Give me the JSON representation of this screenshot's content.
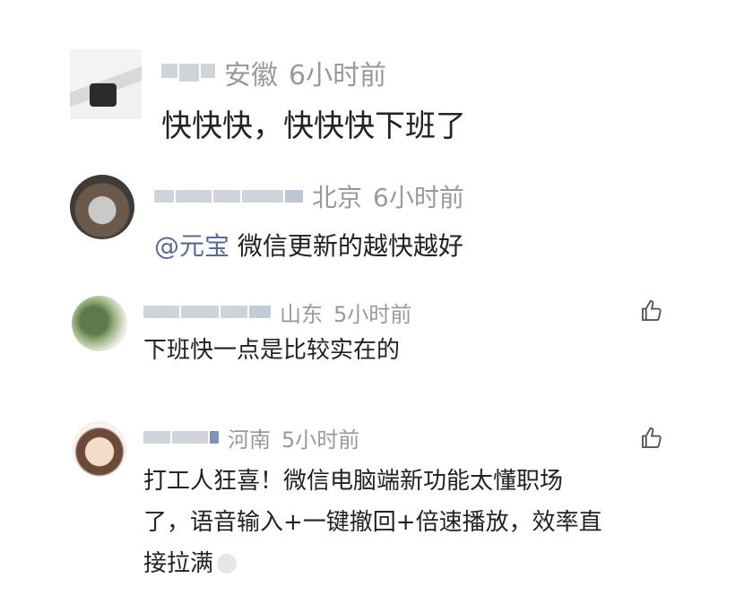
{
  "comments": [
    {
      "region": "安徽",
      "time": "6小时前",
      "text": "快快快，快快快下班了",
      "likeable": false
    },
    {
      "region": "北京",
      "time": "6小时前",
      "mention": "@元宝",
      "text": "微信更新的越快越好",
      "likeable": false
    },
    {
      "region": "山东",
      "time": "5小时前",
      "text": "下班快一点是比较实在的",
      "likeable": true
    },
    {
      "region": "河南",
      "time": "5小时前",
      "lines": [
        "打工人狂喜！微信电脑端新功能太懂职场",
        "了，语音输入+一键撤回+倍速播放，效率直",
        "接拉满"
      ],
      "likeable": true
    }
  ],
  "icons": {
    "like": "thumbs-up-icon",
    "emoji": "emoji-icon"
  },
  "colors": {
    "mention": "#576b95",
    "meta": "#9a9a9a",
    "text": "#222222"
  }
}
